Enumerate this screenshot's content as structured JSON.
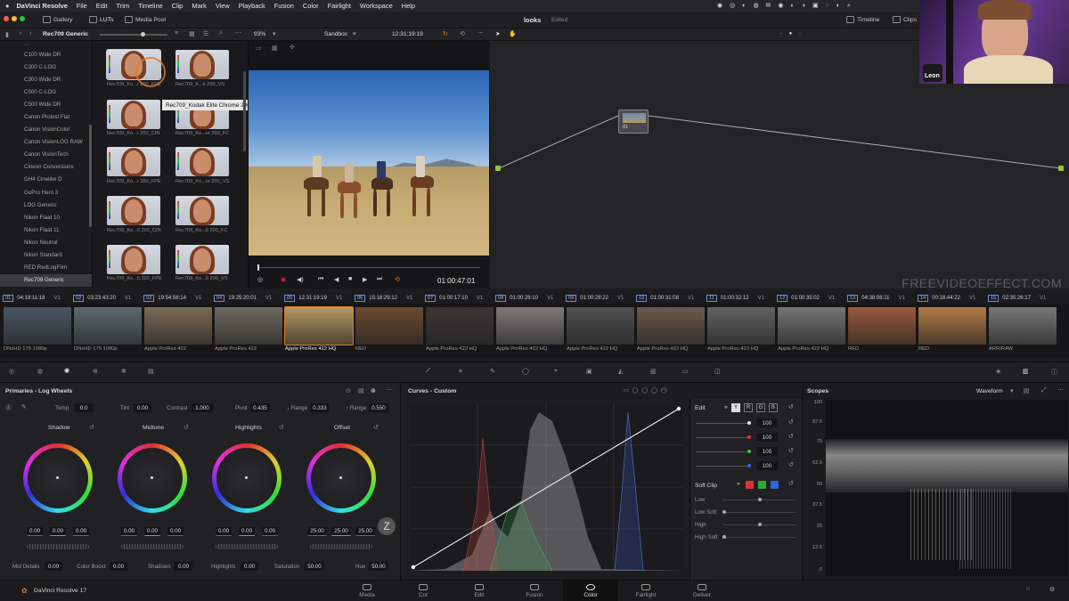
{
  "menubar": {
    "app": "DaVinci Resolve",
    "items": [
      "File",
      "Edit",
      "Trim",
      "Timeline",
      "Clip",
      "Mark",
      "View",
      "Playback",
      "Fusion",
      "Color",
      "Fairlight",
      "Workspace",
      "Help"
    ]
  },
  "toolbar": {
    "gallery": "Gallery",
    "luts": "LUTs",
    "media_pool": "Media Pool",
    "project": "looks",
    "status": "Edited",
    "timeline": "Timeline",
    "clips": "Clips"
  },
  "subbar": {
    "lut_folder": "Rec709 Generic",
    "zoom": "93%",
    "timeline_name": "Sandbox",
    "timecode": "12:31:19:19"
  },
  "lut_list": [
    "C100 Wide DR",
    "C300 C-LOG",
    "C300 Wide DR",
    "C500 C-LOG",
    "C500 Wide DR",
    "Canon Prolost Flat",
    "Canon VisionColor",
    "Canon VisionLOG RAW",
    "Canon VisionTech",
    "Cineon Conversions",
    "GH4 Cinelike D",
    "GoPro Hero 3",
    "LOG Generic",
    "Nikon Flaat 10",
    "Nikon Flaat 11",
    "Nikon Neutral",
    "Nikon Standard",
    "RED RedLogFilm",
    "Rec709 Generic"
  ],
  "lut_selected": "Rec709 Generic",
  "thumbs": [
    {
      "label": "Rec709_Ko...r 200_FPE"
    },
    {
      "label": "Rec709_K...k 200_VS"
    },
    {
      "label": "Rec709_Ko...r 200_CIN"
    },
    {
      "label": "Rec709_Ko...or 200_FC"
    },
    {
      "label": "Rec709_Ko...r 200_FPE"
    },
    {
      "label": "Rec709_Ko...or 200_VS"
    },
    {
      "label": "Rec709_Ko...6 200_CIN"
    },
    {
      "label": "Rec709_Ko...6 200_FC"
    },
    {
      "label": "Rec709_Ko...6 200_FPE"
    },
    {
      "label": "Rec709_Ko...6 200_VS"
    }
  ],
  "tooltip": "Rec709_Kodak Elite Chrome 200_FPE",
  "viewer": {
    "timecode": "01:00:47:01"
  },
  "node": {
    "label": "01"
  },
  "watermark": "FREEVIDEOEFFECT.COM",
  "clips": [
    {
      "num": "01",
      "tc": "04:19:11:18",
      "track": "V1",
      "codec": "DNxHD 175 1080p",
      "tone": "#4a5663"
    },
    {
      "num": "02",
      "tc": "03:23:43:20",
      "track": "V1",
      "codec": "DNxHD 175 1080p",
      "tone": "#5c6a6e"
    },
    {
      "num": "03",
      "tc": "19:54:58:14",
      "track": "V1",
      "codec": "Apple ProRes 422",
      "tone": "#7a6a55"
    },
    {
      "num": "04",
      "tc": "19:25:20:01",
      "track": "V1",
      "codec": "Apple ProRes 422",
      "tone": "#6f6a60"
    },
    {
      "num": "05",
      "tc": "12:31:19:19",
      "track": "V1",
      "codec": "Apple ProRes 422 HQ",
      "tone": "#b69a62"
    },
    {
      "num": "06",
      "tc": "15:18:29:12",
      "track": "V1",
      "codec": "RED",
      "tone": "#6b4a2e"
    },
    {
      "num": "07",
      "tc": "01:00:17:10",
      "track": "V1",
      "codec": "Apple ProRes 422 HQ",
      "tone": "#3a3634"
    },
    {
      "num": "08",
      "tc": "01:00:26:10",
      "track": "V1",
      "codec": "Apple ProRes 422 HQ",
      "tone": "#7d7b78"
    },
    {
      "num": "09",
      "tc": "01:00:28:22",
      "track": "V1",
      "codec": "Apple ProRes 422 HQ",
      "tone": "#505050"
    },
    {
      "num": "10",
      "tc": "01:00:31:08",
      "track": "V1",
      "codec": "Apple ProRes 422 HQ",
      "tone": "#6a5a4d"
    },
    {
      "num": "11",
      "tc": "01:00:32:12",
      "track": "V1",
      "codec": "Apple ProRes 422 HQ",
      "tone": "#626262"
    },
    {
      "num": "12",
      "tc": "01:00:35:02",
      "track": "V1",
      "codec": "Apple ProRes 422 HQ",
      "tone": "#757575"
    },
    {
      "num": "13",
      "tc": "04:38:06:11",
      "track": "V1",
      "codec": "RED",
      "tone": "#9a5a3a"
    },
    {
      "num": "14",
      "tc": "00:18:44:22",
      "track": "V1",
      "codec": "RED",
      "tone": "#b07a45"
    },
    {
      "num": "15",
      "tc": "02:35:26:17",
      "track": "V1",
      "codec": "ARRIRAW",
      "tone": "#777"
    }
  ],
  "primaries": {
    "title": "Primaries - Log Wheels",
    "temp_label": "Temp",
    "temp": "0.0",
    "tint_label": "Tint",
    "tint": "0.00",
    "contrast_label": "Contrast",
    "contrast": "1.000",
    "pivot_label": "Pivot",
    "pivot": "0.435",
    "lrange_label": "↓ Range",
    "lrange": "0.333",
    "hrange_label": "↑ Range",
    "hrange": "0.550",
    "wheels": [
      {
        "name": "Shadow",
        "values": [
          "0.00",
          "0.00",
          "0.00"
        ]
      },
      {
        "name": "Midtone",
        "values": [
          "0.00",
          "0.00",
          "0.00"
        ]
      },
      {
        "name": "Highlights",
        "values": [
          "0.00",
          "0.00",
          "0.00"
        ]
      },
      {
        "name": "Offset",
        "values": [
          "25.00",
          "25.00",
          "25.00"
        ]
      }
    ],
    "mid_details_label": "Mid Details",
    "mid_details": "0.00",
    "color_boost_label": "Color Boost",
    "color_boost": "0.00",
    "shadows_label": "Shadows",
    "shadows": "0.00",
    "highlights_label": "Highlights",
    "highlights": "0.00",
    "saturation_label": "Saturation",
    "saturation": "50.00",
    "hue_label": "Hue",
    "hue": "50.00"
  },
  "curves": {
    "title": "Curves - Custom",
    "edit": "Edit",
    "channels": [
      "Y",
      "R",
      "G",
      "B"
    ],
    "levels": [
      "100",
      "100",
      "100",
      "100"
    ],
    "soft_clip": "Soft Clip",
    "soft_items": [
      "Low",
      "Low Soft",
      "High",
      "High Soft"
    ]
  },
  "scopes": {
    "title": "Scopes",
    "mode": "Waveform",
    "ticks": [
      "100",
      "87.5",
      "75",
      "62.5",
      "50",
      "37.5",
      "25",
      "12.5",
      "0"
    ]
  },
  "pages": [
    "Media",
    "Cut",
    "Edit",
    "Fusion",
    "Color",
    "Fairlight",
    "Deliver"
  ],
  "active_page": "Color",
  "brand": "DaVinci Resolve 17",
  "cam_name": "Leon",
  "colors": {
    "accent": "#e07a2a",
    "selection": "#6a8dd6"
  }
}
